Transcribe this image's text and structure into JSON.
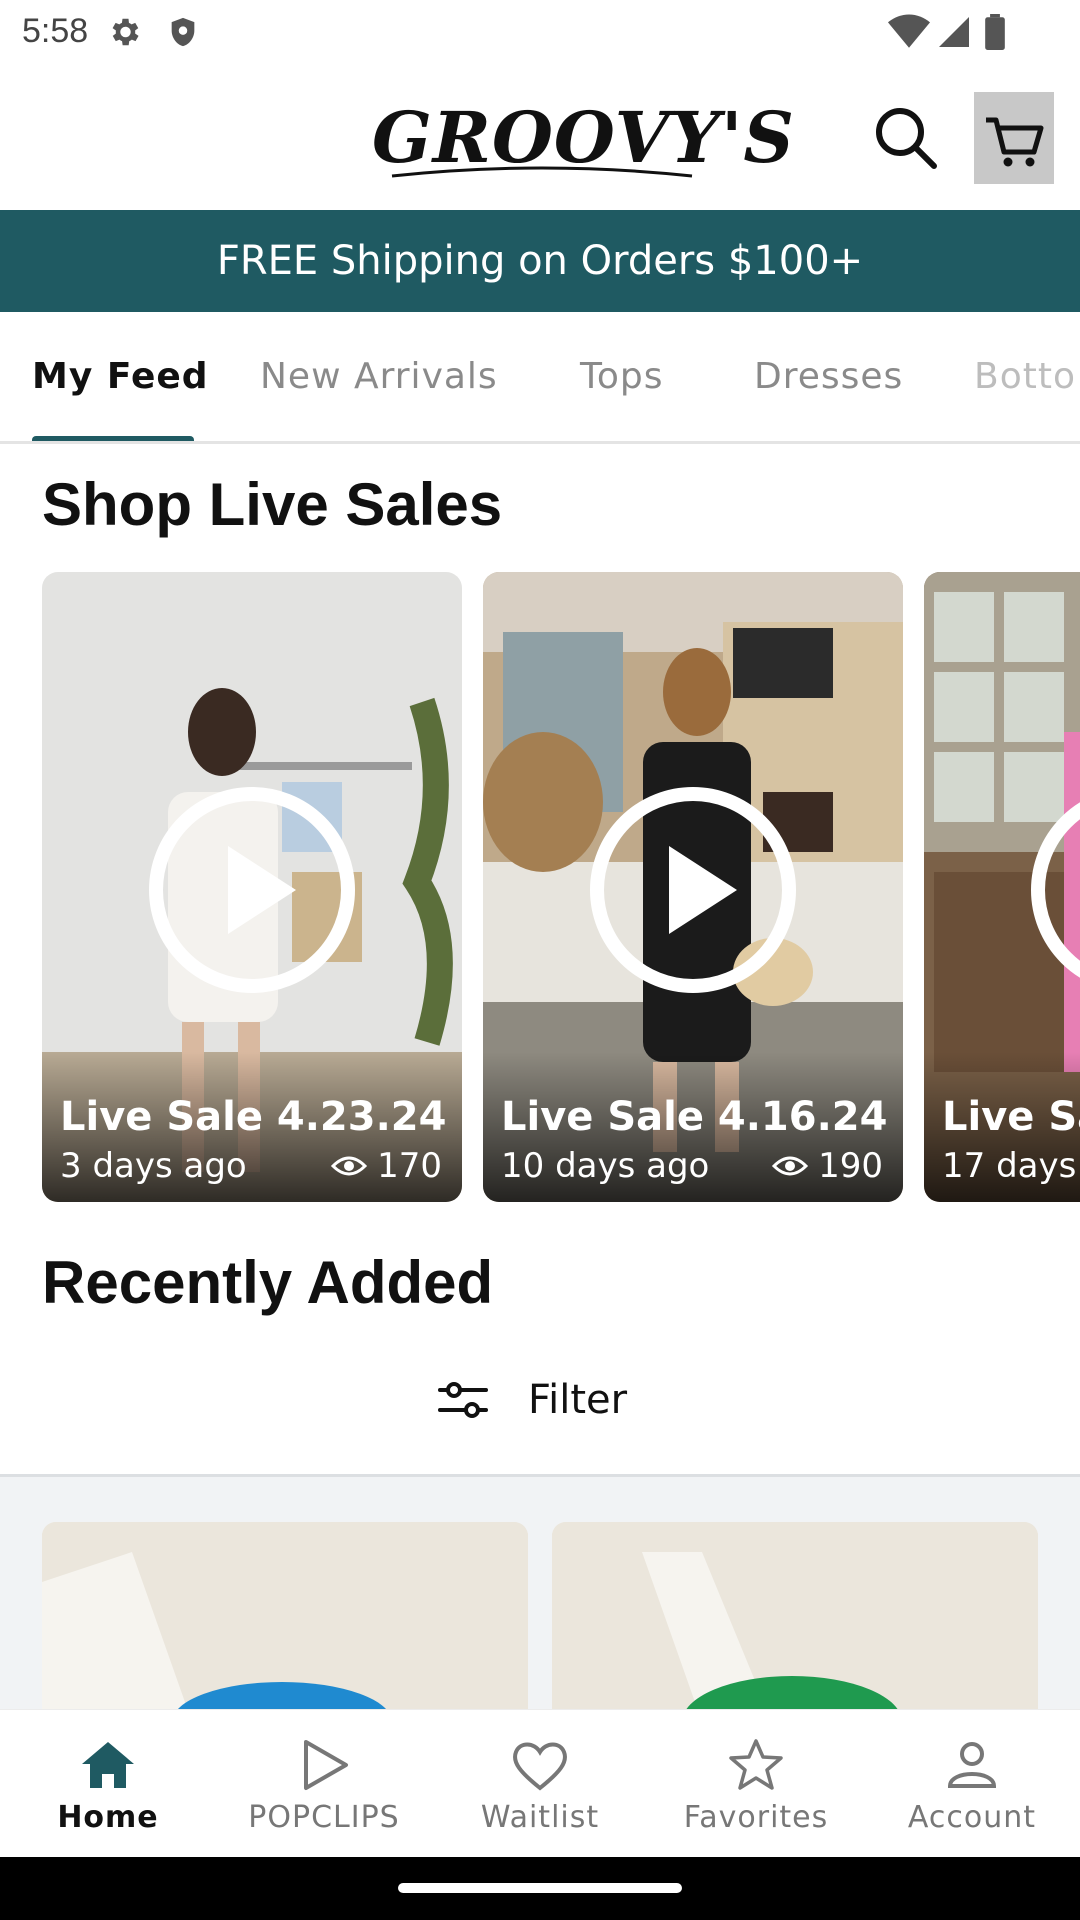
{
  "status_bar": {
    "time": "5:58",
    "icons": [
      "settings-icon",
      "shield-icon",
      "wifi-icon",
      "signal-icon",
      "battery-icon"
    ]
  },
  "header": {
    "logo_text": "GROOVY'S",
    "search_icon": "search-icon",
    "cart_icon": "cart-icon"
  },
  "banner": {
    "text": "FREE Shipping on Orders $100+",
    "background": "#1f5a62"
  },
  "tabs": {
    "items": [
      "My Feed",
      "New Arrivals",
      "Tops",
      "Dresses",
      "Botto"
    ],
    "active_index": 0,
    "accent": "#1f5a62"
  },
  "live_sales": {
    "title": "Shop Live Sales",
    "cards": [
      {
        "title": "Live Sale 4.23.24",
        "age": "3 days ago",
        "views": "170"
      },
      {
        "title": "Live Sale 4.16.24",
        "age": "10 days ago",
        "views": "190"
      },
      {
        "title": "Live Sa",
        "age": "17 days",
        "views": ""
      }
    ]
  },
  "recently_added": {
    "title": "Recently Added",
    "filter_label": "Filter"
  },
  "bottom_nav": {
    "items": [
      {
        "label": "Home",
        "icon": "home-icon",
        "active": true
      },
      {
        "label": "POPCLIPS",
        "icon": "play-icon",
        "active": false
      },
      {
        "label": "Waitlist",
        "icon": "heart-icon",
        "active": false
      },
      {
        "label": "Favorites",
        "icon": "star-icon",
        "active": false
      },
      {
        "label": "Account",
        "icon": "person-icon",
        "active": false
      }
    ]
  }
}
